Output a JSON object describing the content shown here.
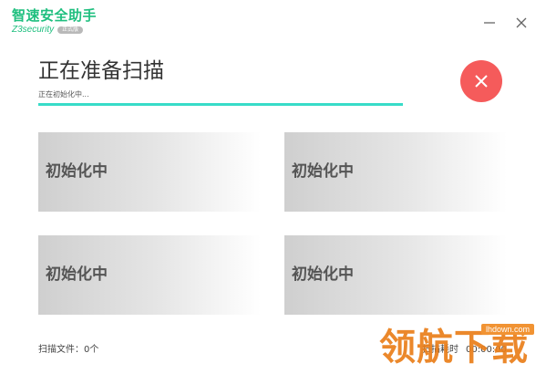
{
  "app": {
    "title": "智速安全助手",
    "subtitle": "Z3security",
    "badge": "正式版"
  },
  "window_controls": {
    "minimize_icon": "minus-icon",
    "close_icon": "close-icon"
  },
  "scan": {
    "title": "正在准备扫描",
    "status": "正在初始化中...",
    "progress": 1.0,
    "colors": {
      "accent": "#38dcc8",
      "stop": "#f55b5b",
      "brand": "#1fbf7f"
    }
  },
  "cards": [
    {
      "label": "初始化中"
    },
    {
      "label": "初始化中"
    },
    {
      "label": "初始化中"
    },
    {
      "label": "初始化中"
    }
  ],
  "footer": {
    "scanned_files": "扫描文件：0个",
    "elapsed_label": "扫描耗时",
    "elapsed_time": "00:00:00"
  },
  "watermark": {
    "text": "领航下载",
    "url": "lhdown.com"
  }
}
